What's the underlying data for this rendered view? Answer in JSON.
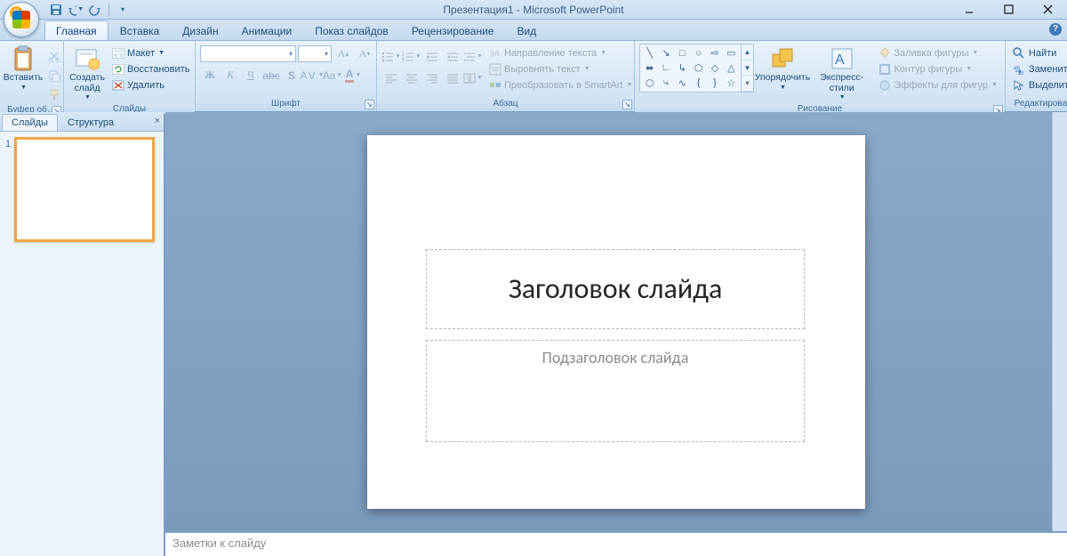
{
  "app": {
    "title": "Презентация1 - Microsoft PowerPoint"
  },
  "qat": {
    "save": "save",
    "undo": "undo",
    "redo": "redo"
  },
  "tabs": {
    "home": "Главная",
    "insert": "Вставка",
    "design": "Дизайн",
    "animations": "Анимации",
    "slideshow": "Показ слайдов",
    "review": "Рецензирование",
    "view": "Вид"
  },
  "groups": {
    "clipboard": {
      "label": "Буфер об…",
      "paste": "Вставить"
    },
    "slides": {
      "label": "Слайды",
      "new": "Создать\nслайд",
      "layout": "Макет",
      "reset": "Восстановить",
      "delete": "Удалить"
    },
    "font": {
      "label": "Шрифт"
    },
    "paragraph": {
      "label": "Абзац",
      "direction": "Направление текста",
      "align": "Выровнять текст",
      "smartart": "Преобразовать в SmartArt"
    },
    "drawing": {
      "label": "Рисование",
      "arrange": "Упорядочить",
      "styles": "Экспресс-стили",
      "fill": "Заливка фигуры",
      "outline": "Контур фигуры",
      "effects": "Эффекты для фигур"
    },
    "editing": {
      "label": "Редактирование",
      "find": "Найти",
      "replace": "Заменить",
      "select": "Выделить"
    }
  },
  "side": {
    "tab_slides": "Слайды",
    "tab_outline": "Структура",
    "slide_num": "1"
  },
  "slide": {
    "title": "Заголовок слайда",
    "subtitle": "Подзаголовок слайда"
  },
  "notes": {
    "placeholder": "Заметки к слайду"
  }
}
